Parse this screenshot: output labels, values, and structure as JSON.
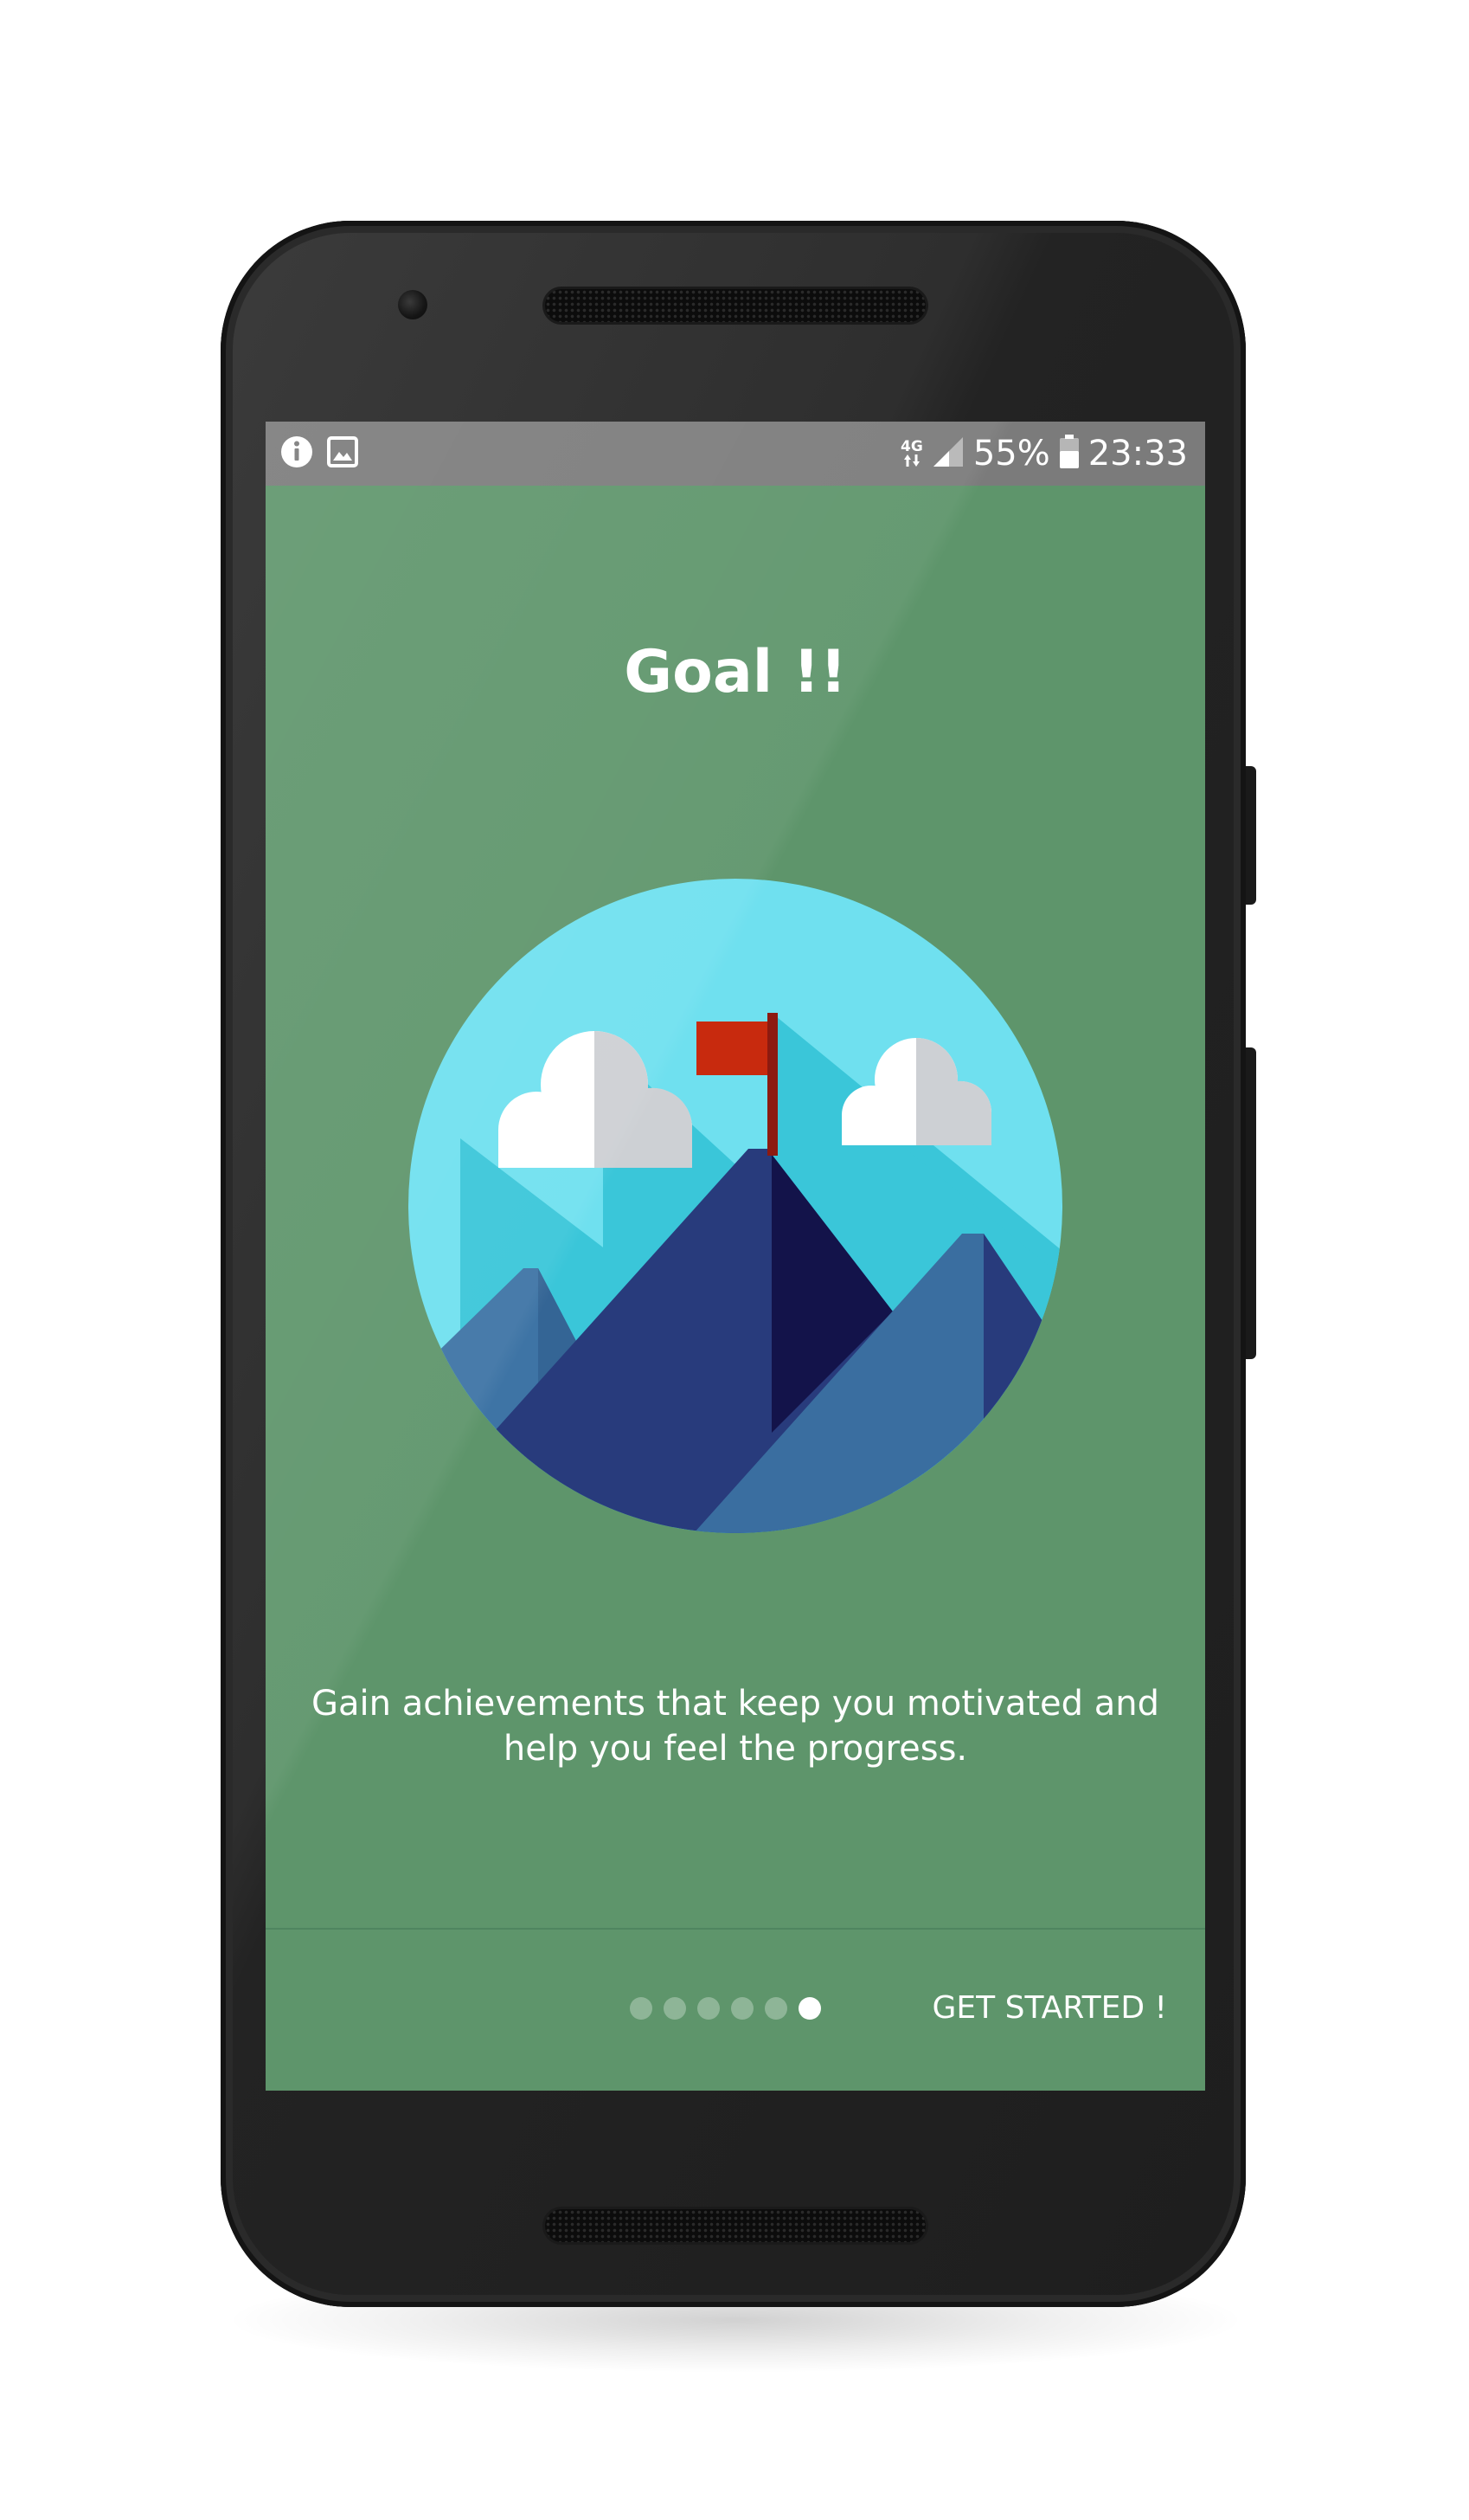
{
  "status_bar": {
    "network": "4G",
    "battery": "55%",
    "time": "23:33",
    "left_icons": [
      "info-icon",
      "gallery-icon"
    ],
    "right_icons": [
      "network-arrows-icon",
      "signal-icon",
      "battery-icon"
    ]
  },
  "onboarding": {
    "title": "Goal !!",
    "description": "Gain achievements that keep you motivated and help you feel the progress.",
    "illustration": "mountain-flag-illustration",
    "page_count": 6,
    "current_page": 6,
    "get_started_label": "GET STARTED !"
  },
  "colors": {
    "screen_background": "#5e956b",
    "status_bar": "#7b7b7b",
    "sky": "#6fe0ef",
    "flag": "#c82a0e",
    "mountain_dark": "#283b7c",
    "mountain_shadow": "#13134a",
    "mountain_light": "#3a6ea0",
    "cloud": "#ffffff",
    "cloud_shade": "#cdd0d4"
  }
}
